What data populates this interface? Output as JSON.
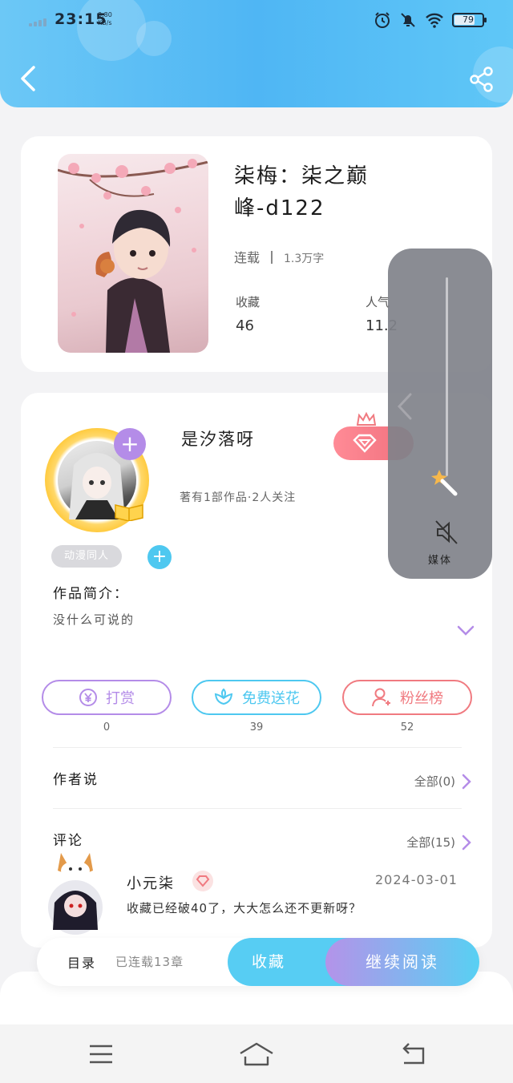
{
  "status_bar": {
    "time": "23:15",
    "net_speed_value": "0.80",
    "net_speed_unit": "KB/s",
    "battery": "79"
  },
  "header": {
    "back_icon": "chevron-left-icon",
    "share_icon": "share-icon"
  },
  "book": {
    "title": "柒梅：柒之巅峰-d122",
    "status": "连载",
    "word_count": "1.3万字",
    "favorites_label": "收藏",
    "favorites_value": "46",
    "popularity_label": "人气",
    "popularity_value": "11.2"
  },
  "author": {
    "name": "是汐落呀",
    "info": "著有1部作品·2人关注",
    "tag": "动漫同人",
    "intro_label": "作品简介：",
    "intro_text": "没什么可说的"
  },
  "actions": [
    {
      "label": "打赏",
      "count": "0",
      "color": "#b48ce8",
      "icon": "yen-icon"
    },
    {
      "label": "免费送花",
      "count": "39",
      "color": "#4ec8f0",
      "icon": "flower-icon"
    },
    {
      "label": "粉丝榜",
      "count": "52",
      "color": "#f07a80",
      "icon": "fans-icon"
    }
  ],
  "author_says": {
    "title": "作者说",
    "all": "全部(0)"
  },
  "comments": {
    "title": "评论",
    "all": "全部(15)",
    "first": {
      "user": "小元柒",
      "date": "2024-03-01",
      "text": "收藏已经破40了，大大怎么还不更新呀？"
    }
  },
  "bottom_bar": {
    "toc": "目录",
    "toc_info": "已连载13章",
    "favorite": "收藏",
    "continue": "继续阅读"
  },
  "volume_panel": {
    "label": "媒体",
    "level": 0.1
  },
  "colors": {
    "accent_blue": "#4fb6f4",
    "accent_purple": "#b48ce8",
    "accent_red": "#f07a80"
  }
}
